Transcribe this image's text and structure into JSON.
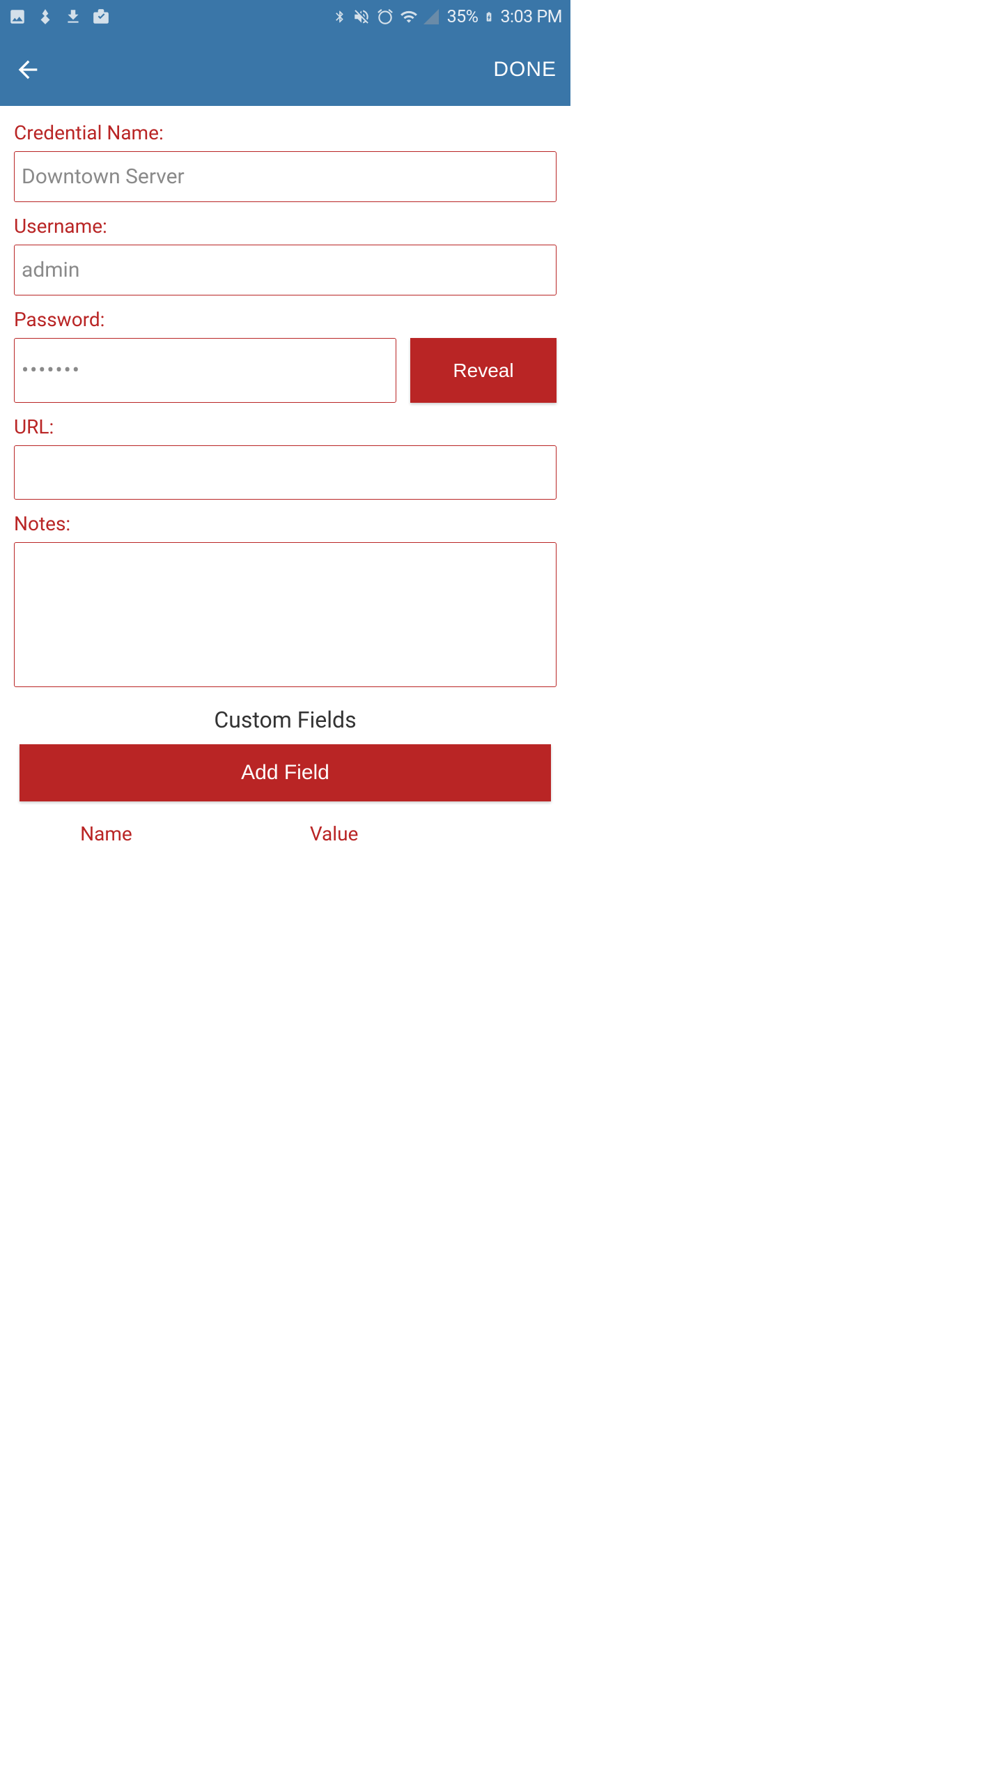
{
  "status_bar": {
    "battery_text": "35%",
    "time": "3:03 PM"
  },
  "app_bar": {
    "done_label": "DONE"
  },
  "form": {
    "credential_name": {
      "label": "Credential Name:",
      "value": "Downtown Server"
    },
    "username": {
      "label": "Username:",
      "value": "admin"
    },
    "password": {
      "label": "Password:",
      "value": "•••••••",
      "reveal_label": "Reveal"
    },
    "url": {
      "label": "URL:",
      "value": ""
    },
    "notes": {
      "label": "Notes:",
      "value": ""
    }
  },
  "custom_fields": {
    "header": "Custom Fields",
    "add_button_label": "Add Field",
    "columns": {
      "name": "Name",
      "value": "Value"
    }
  }
}
